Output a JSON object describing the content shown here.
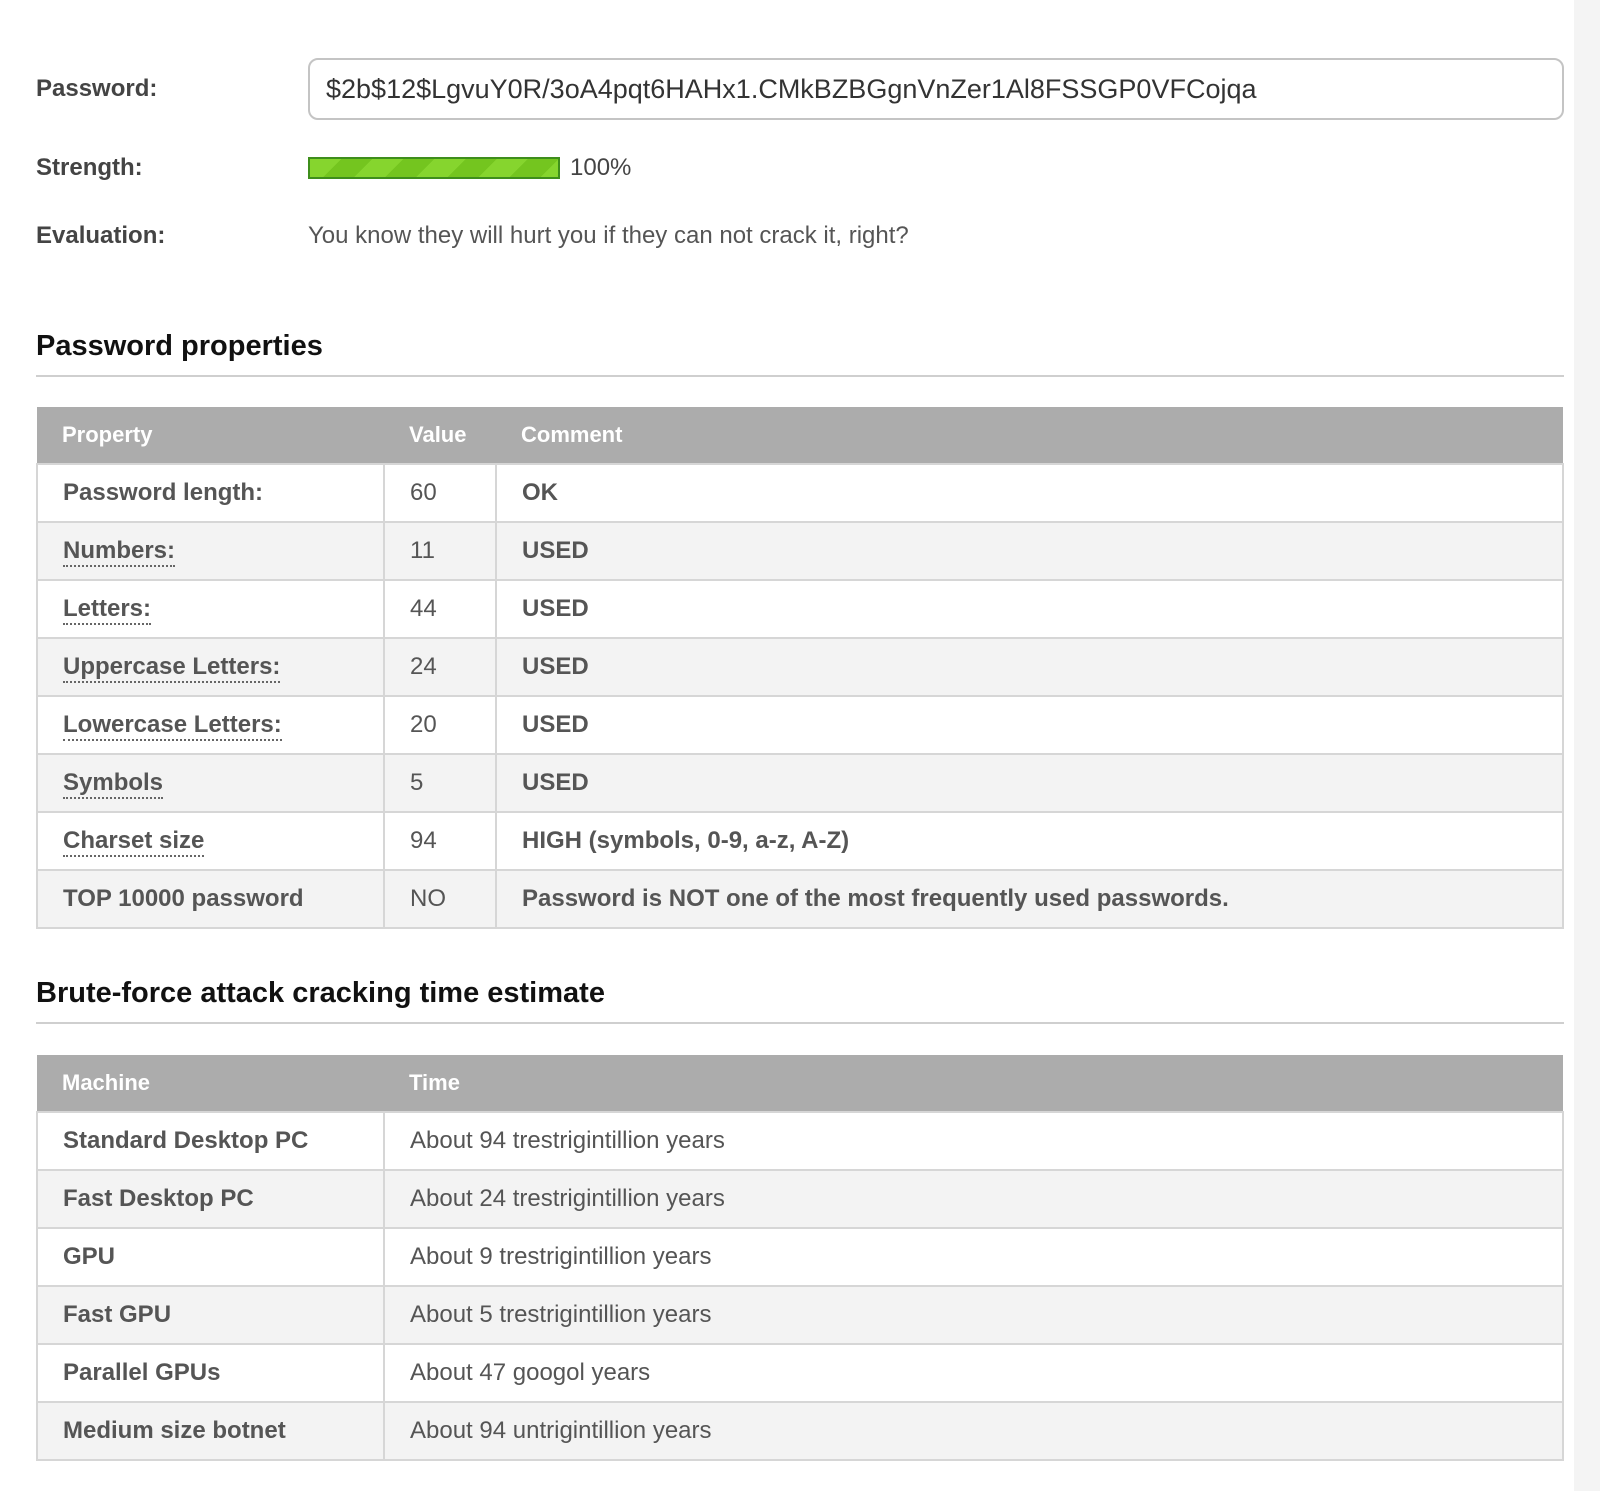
{
  "form": {
    "password_label": "Password:",
    "password_value": "$2b$12$LgvuY0R/3oA4pqt6HAHx1.CMkBZBGgnVnZer1Al8FSSGP0VFCojqa",
    "strength_label": "Strength:",
    "strength_fraction": 1.0,
    "strength_text": "100%",
    "evaluation_label": "Evaluation:",
    "evaluation_text": "You know they will hurt you if they can not crack it, right?"
  },
  "colors": {
    "accent_green": "#3d7a14",
    "meter_green": "#86d52e",
    "table_header": "#acacac"
  },
  "properties": {
    "title": "Password properties",
    "headers": [
      "Property",
      "Value",
      "Comment"
    ],
    "rows": [
      {
        "property": "Password length:",
        "value": "60",
        "comment": "OK"
      },
      {
        "property": "Numbers:",
        "value": "11",
        "comment": "USED"
      },
      {
        "property": "Letters:",
        "value": "44",
        "comment": "USED"
      },
      {
        "property": "Uppercase Letters:",
        "value": "24",
        "comment": "USED"
      },
      {
        "property": "Lowercase Letters:",
        "value": "20",
        "comment": "USED"
      },
      {
        "property": "Symbols",
        "value": "5",
        "comment": "USED"
      },
      {
        "property": "Charset size",
        "value": "94",
        "comment": "HIGH (symbols, 0-9, a-z, A-Z)"
      },
      {
        "property": "TOP 10000 password",
        "value": "NO",
        "comment": "Password is NOT one of the most frequently used passwords."
      }
    ]
  },
  "bruteforce": {
    "title": "Brute-force attack cracking time estimate",
    "headers": [
      "Machine",
      "Time"
    ],
    "rows": [
      {
        "machine": "Standard Desktop PC",
        "time": "About 94 trestrigintillion years"
      },
      {
        "machine": "Fast Desktop PC",
        "time": "About 24 trestrigintillion years"
      },
      {
        "machine": "GPU",
        "time": "About 9 trestrigintillion years"
      },
      {
        "machine": "Fast GPU",
        "time": "About 5 trestrigintillion years"
      },
      {
        "machine": "Parallel GPUs",
        "time": "About 47 googol years"
      },
      {
        "machine": "Medium size botnet",
        "time": "About 94 untrigintillion years"
      }
    ]
  }
}
